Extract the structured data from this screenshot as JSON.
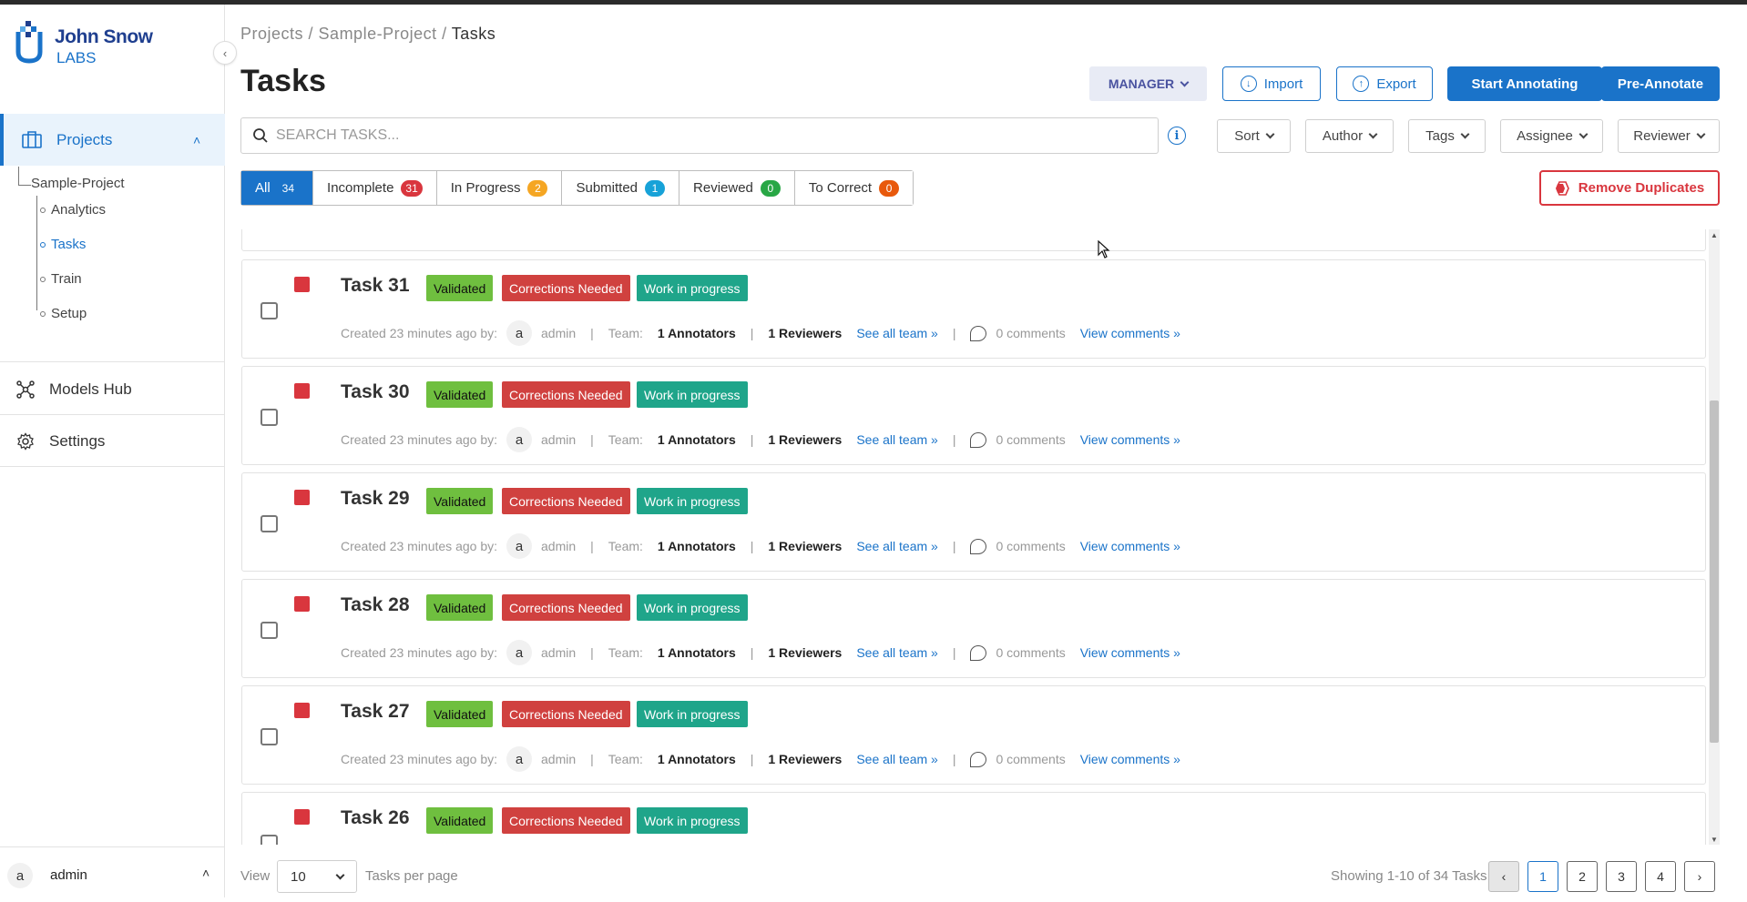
{
  "brand": {
    "line1": "John Snow",
    "line2": "LABS"
  },
  "sidebar": {
    "projects_label": "Projects",
    "tree": {
      "project": "Sample-Project",
      "children": [
        "Analytics",
        "Tasks",
        "Train",
        "Setup"
      ],
      "active": "Tasks"
    },
    "models_hub": "Models Hub",
    "settings": "Settings",
    "user": {
      "initial": "a",
      "name": "admin"
    }
  },
  "breadcrumb": {
    "items": [
      "Projects",
      "Sample-Project"
    ],
    "current": "Tasks"
  },
  "page": {
    "title": "Tasks"
  },
  "toolbar": {
    "role": "MANAGER",
    "import": "Import",
    "export": "Export",
    "start_annotating": "Start Annotating",
    "pre_annotate": "Pre-Annotate"
  },
  "search": {
    "placeholder": "SEARCH TASKS..."
  },
  "filters": [
    "Sort",
    "Author",
    "Tags",
    "Assignee",
    "Reviewer"
  ],
  "status_tabs": [
    {
      "label": "All",
      "count": "34",
      "color": "#1a73c9"
    },
    {
      "label": "Incomplete",
      "count": "31",
      "color": "#d9363e"
    },
    {
      "label": "In Progress",
      "count": "2",
      "color": "#f5a623"
    },
    {
      "label": "Submitted",
      "count": "1",
      "color": "#17a2d8"
    },
    {
      "label": "Reviewed",
      "count": "0",
      "color": "#28a745"
    },
    {
      "label": "To Correct",
      "count": "0",
      "color": "#e8590c"
    }
  ],
  "remove_duplicates": "Remove Duplicates",
  "tags": {
    "validated": "Validated",
    "corrections": "Corrections Needed",
    "wip": "Work in progress"
  },
  "meta_labels": {
    "created": "Created 23 minutes ago by:",
    "author_initial": "a",
    "author": "admin",
    "team": "Team:",
    "annotators": "1 Annotators",
    "reviewers": "1 Reviewers",
    "see_team": "See all team »",
    "comments": "0 comments",
    "view_comments": "View comments »"
  },
  "tasks": [
    {
      "title": "Task 31"
    },
    {
      "title": "Task 30"
    },
    {
      "title": "Task 29"
    },
    {
      "title": "Task 28"
    },
    {
      "title": "Task 27"
    },
    {
      "title": "Task 26"
    }
  ],
  "footer": {
    "view": "View",
    "per_page_value": "10",
    "per_page_label": "Tasks per page",
    "showing": "Showing 1-10 of 34 Tasks",
    "pages": [
      "1",
      "2",
      "3",
      "4"
    ],
    "current_page": "1"
  }
}
